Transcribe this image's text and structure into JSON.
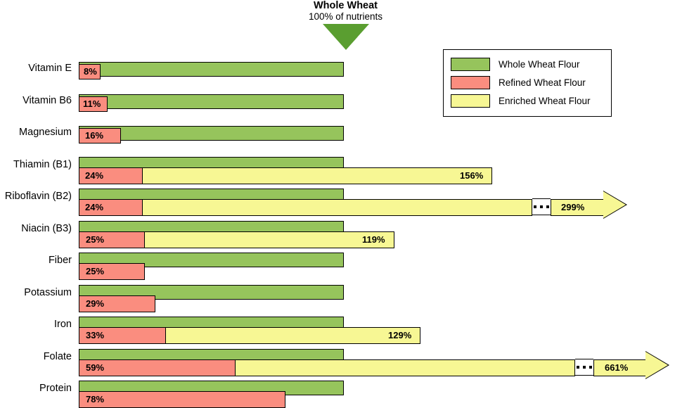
{
  "marker": {
    "title": "Whole Wheat",
    "subtitle": "100% of nutrients"
  },
  "legend": {
    "items": [
      {
        "label": "Whole Wheat Flour",
        "color": "#96c45c"
      },
      {
        "label": "Refined Wheat Flour",
        "color": "#fa8d7f"
      },
      {
        "label": "Enriched Wheat Flour",
        "color": "#f7f794"
      }
    ]
  },
  "chart_data": {
    "type": "bar",
    "title": "Whole Wheat 100% of nutrients",
    "xlabel": "",
    "ylabel": "",
    "categories": [
      "Vitamin E",
      "Vitamin B6",
      "Magnesium",
      "Thiamin (B1)",
      "Riboflavin (B2)",
      "Niacin (B3)",
      "Fiber",
      "Potassium",
      "Iron",
      "Folate",
      "Protein"
    ],
    "series": [
      {
        "name": "Whole Wheat Flour",
        "color": "#96c45c",
        "values": [
          100,
          100,
          100,
          100,
          100,
          100,
          100,
          100,
          100,
          100,
          100
        ]
      },
      {
        "name": "Refined Wheat Flour",
        "color": "#fa8d7f",
        "values": [
          8,
          11,
          16,
          24,
          24,
          25,
          25,
          29,
          33,
          59,
          78
        ]
      },
      {
        "name": "Enriched Wheat Flour",
        "color": "#f7f794",
        "values": [
          null,
          null,
          null,
          156,
          299,
          119,
          null,
          null,
          129,
          661,
          null
        ]
      }
    ],
    "labels": {
      "refined": [
        "8%",
        "11%",
        "16%",
        "24%",
        "24%",
        "25%",
        "25%",
        "29%",
        "33%",
        "59%",
        "78%"
      ],
      "enriched": [
        "",
        "",
        "",
        "156%",
        "299%",
        "119%",
        "",
        "",
        "129%",
        "661%",
        ""
      ]
    },
    "axis_reference": 100,
    "grid": false,
    "legend_position": "top-right",
    "broken_axis_rows": [
      "Riboflavin (B2)",
      "Folate"
    ]
  }
}
